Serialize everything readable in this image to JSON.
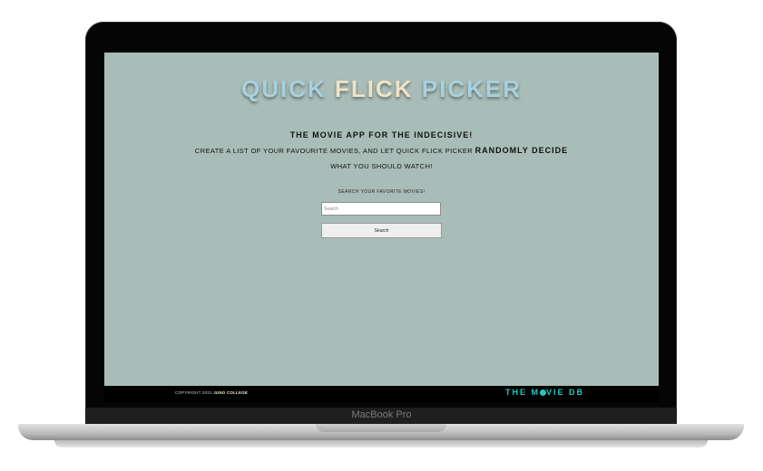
{
  "app": {
    "title_left": "QUICK",
    "title_mid": " FLICK ",
    "title_right": "PICKER"
  },
  "intro": {
    "tagline": "THE MOVIE APP FOR THE INDECISIVE!",
    "line1": "CREATE A LIST OF YOUR FAVOURITE MOVIES, AND LET QUICK FLICK PICKER",
    "line1_emphasis": "RANDOMLY DECIDE",
    "line2": "WHAT YOU SHOULD WATCH!"
  },
  "search": {
    "label": "SEARCH YOUR FAVORITE MOVIES!",
    "placeholder": "Search",
    "value": "",
    "button_label": "Search"
  },
  "footer": {
    "copyright_prefix": "COPYRIGHT 2021",
    "copyright_brand": "JUNO COLLEGE",
    "tmdb_left": "THE M",
    "tmdb_right": "VIE DB"
  },
  "device": {
    "label": "MacBook Pro"
  },
  "colors": {
    "screen_bg": "#a8bdb7",
    "title_blue": "#a8d0df",
    "title_cream": "#efe3c6",
    "tmdb_teal": "#20c8c0"
  },
  "icons": {
    "tmdb_logo_dot": "filled-circle"
  }
}
